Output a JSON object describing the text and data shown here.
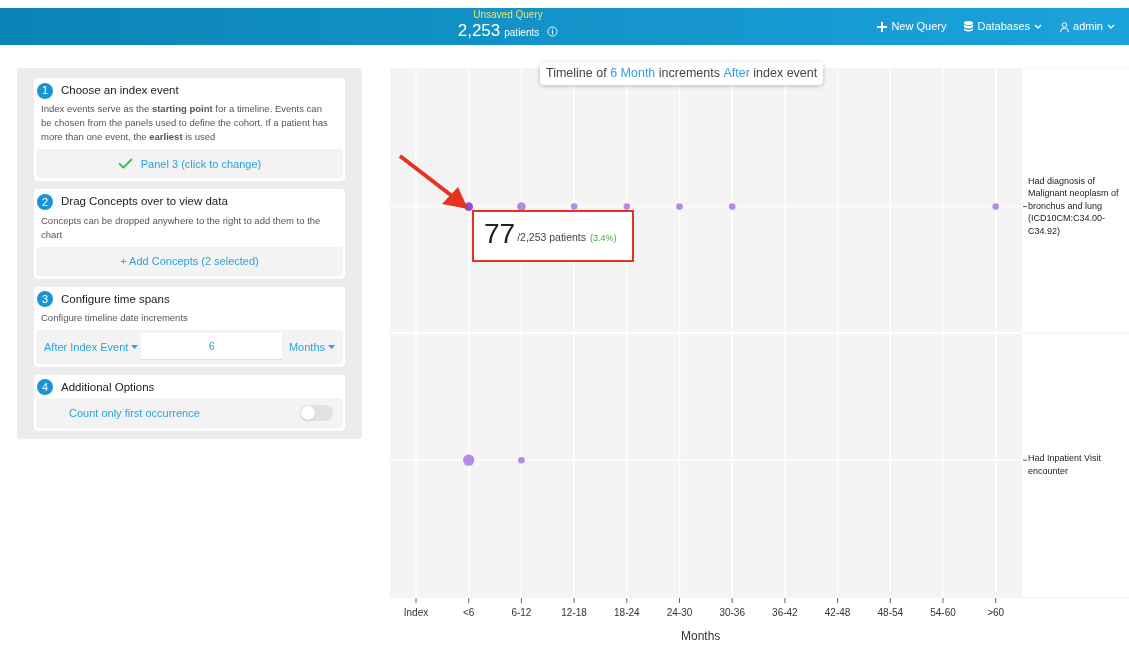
{
  "header": {
    "query_name": "Unsaved Query",
    "patient_count": "2,253",
    "patient_label": "patients",
    "actions": [
      {
        "kind": "new",
        "label": "New Query"
      },
      {
        "kind": "databases",
        "label": "Databases"
      },
      {
        "kind": "user",
        "label": "admin"
      }
    ]
  },
  "steps": [
    {
      "number": "1",
      "title": "Choose an index event",
      "description": "Index events serve as the **starting point** for a timeline. Events can be chosen from the panels used to define the cohort. If a patient has more than one event, the **earliest** is used",
      "kind": "choice",
      "value": "Panel 3 (click to change)",
      "checked": true
    },
    {
      "number": "2",
      "title": "Drag Concepts over to view data",
      "description": "Concepts can be dropped anywhere to the right to add them to the chart",
      "kind": "button",
      "value": "+ Add Concepts (2 selected)"
    },
    {
      "number": "3",
      "title": "Configure time spans",
      "description": "Configure timeline date increments",
      "kind": "timespan",
      "direction": "After Index Event",
      "amount": "6",
      "unit": "Months"
    },
    {
      "number": "4",
      "title": "Additional Options",
      "kind": "toggle",
      "value": "Count only first occurrence",
      "on": false
    }
  ],
  "timeline_title": {
    "prefix": "Timeline of ",
    "amount": "6 Month",
    "middle": " increments ",
    "direction": "After",
    "suffix": " index event"
  },
  "timeline": {
    "x_title": "Months",
    "columns": [
      "Index",
      "<6",
      "6-12",
      "12-18",
      "18-24",
      "24-30",
      "30-36",
      "36-42",
      "42-48",
      "48-54",
      "54-60",
      ">60"
    ],
    "rows": [
      {
        "label": "Had diagnosis of Malignant neoplasm of bronchus and lung (ICD10CM:C34.00-C34.92)",
        "points": [
          {
            "kind": "none"
          },
          {
            "kind": "highlighted"
          },
          {
            "kind": "medium"
          },
          {
            "kind": "small"
          },
          {
            "kind": "small"
          },
          {
            "kind": "small"
          },
          {
            "kind": "small"
          },
          {
            "kind": "none"
          },
          {
            "kind": "none"
          },
          {
            "kind": "none"
          },
          {
            "kind": "none"
          },
          {
            "kind": "small"
          }
        ]
      },
      {
        "label": "Had Inpatient Visit encounter",
        "points": [
          {
            "kind": "none"
          },
          {
            "kind": "large"
          },
          {
            "kind": "small"
          },
          {
            "kind": "none"
          },
          {
            "kind": "none"
          },
          {
            "kind": "none"
          },
          {
            "kind": "none"
          },
          {
            "kind": "none"
          },
          {
            "kind": "none"
          },
          {
            "kind": "none"
          },
          {
            "kind": "none"
          },
          {
            "kind": "none"
          }
        ]
      }
    ]
  },
  "tooltip": {
    "count": "77",
    "total": "/2,253 patients",
    "percent": "(3.4%)"
  }
}
